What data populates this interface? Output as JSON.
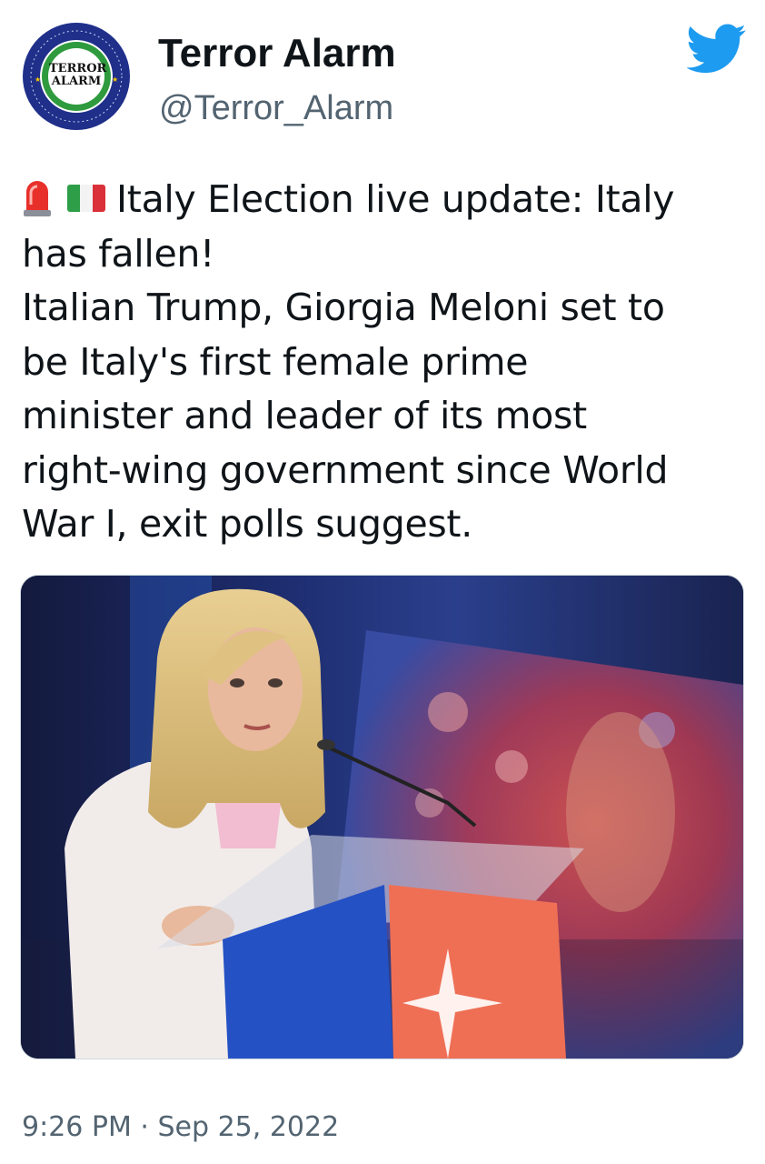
{
  "author": {
    "display_name": "Terror Alarm",
    "handle": "@Terror_Alarm",
    "avatar": {
      "ring_text_top": "TERROR ALARM",
      "center_line1": "TERROR",
      "center_line2": "ALARM",
      "ring_text_bottom": "www.TerrorAlarm.org"
    }
  },
  "platform_icon": "twitter-bird-icon",
  "tweet": {
    "emoji": [
      "police-light-icon",
      "italy-flag-icon"
    ],
    "lines": [
      "Italy Election live update: Italy",
      "has fallen!",
      "Italian Trump, Giorgia Meloni set to",
      "be Italy's first female prime",
      "minister and leader of its most",
      "right-wing government since World",
      "War I, exit polls suggest."
    ]
  },
  "media": {
    "kind": "photo",
    "subject": "woman-at-podium"
  },
  "timestamp": "9:26 PM · Sep 25, 2022",
  "colors": {
    "text": "#0f1419",
    "secondary": "#536471",
    "twitter_blue": "#1d9bf0",
    "border": "#cfd9de"
  }
}
